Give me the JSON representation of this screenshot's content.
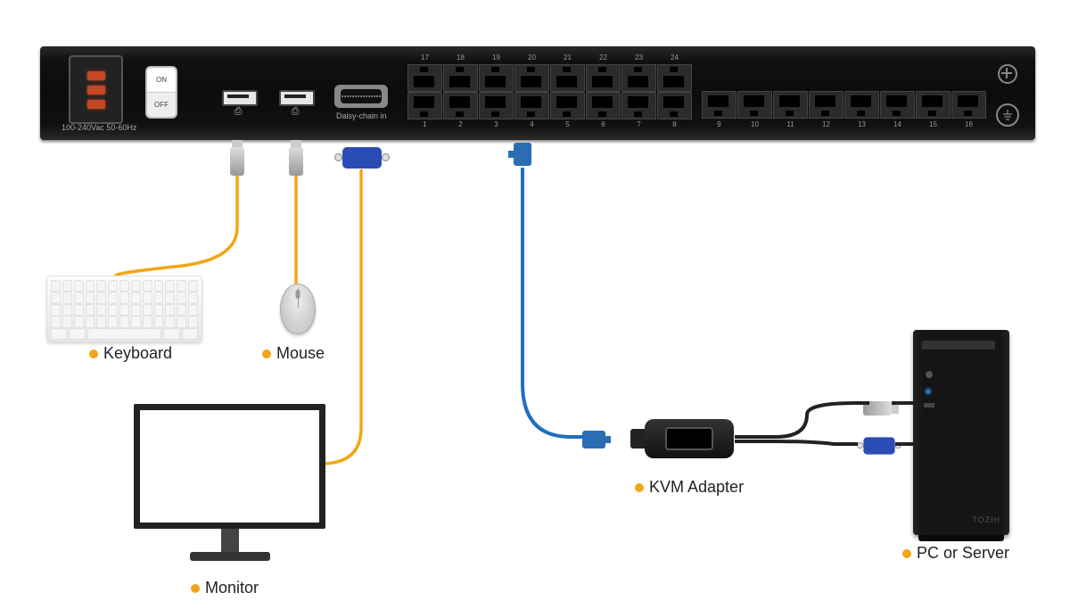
{
  "domain": "Diagram",
  "title": "Rack KVM Switch connection diagram",
  "device": {
    "psu_label": "100-240Vac 50-60Hz",
    "toggle": {
      "on": "ON",
      "off": "OFF"
    },
    "usb_icon": "⎙",
    "daisy_chain_label": "Daisy-chain in",
    "top_port_numbers": [
      "17",
      "18",
      "19",
      "20",
      "21",
      "22",
      "23",
      "24"
    ],
    "bottom_port_numbers_a": [
      "1",
      "2",
      "3",
      "4",
      "5",
      "6",
      "7",
      "8"
    ],
    "bottom_port_numbers_b": [
      "9",
      "10",
      "11",
      "12",
      "13",
      "14",
      "15",
      "16"
    ]
  },
  "labels": {
    "keyboard": "Keyboard",
    "mouse": "Mouse",
    "monitor": "Monitor",
    "kvm": "KVM Adapter",
    "pc": "PC or Server"
  },
  "colors": {
    "accent": "#f2a516",
    "usb_cable": "#f2a516",
    "lan_cable": "#1e6fbf",
    "vga_cable": "#2a4db5",
    "pc_cable": "#222"
  },
  "connections": [
    {
      "from": "KVM USB port 1",
      "to": "Keyboard",
      "cable": "USB",
      "color": "orange"
    },
    {
      "from": "KVM USB port 2",
      "to": "Mouse",
      "cable": "USB",
      "color": "orange"
    },
    {
      "from": "KVM Daisy-chain in (VGA)",
      "to": "Monitor",
      "cable": "VGA",
      "color": "orange"
    },
    {
      "from": "KVM RJ45 port 4",
      "to": "KVM Adapter",
      "cable": "Cat5e",
      "color": "blue"
    },
    {
      "from": "KVM Adapter",
      "to": "PC or Server",
      "cable": "USB + VGA",
      "color": "black/blue"
    }
  ],
  "pc_brand": "TOZIH"
}
